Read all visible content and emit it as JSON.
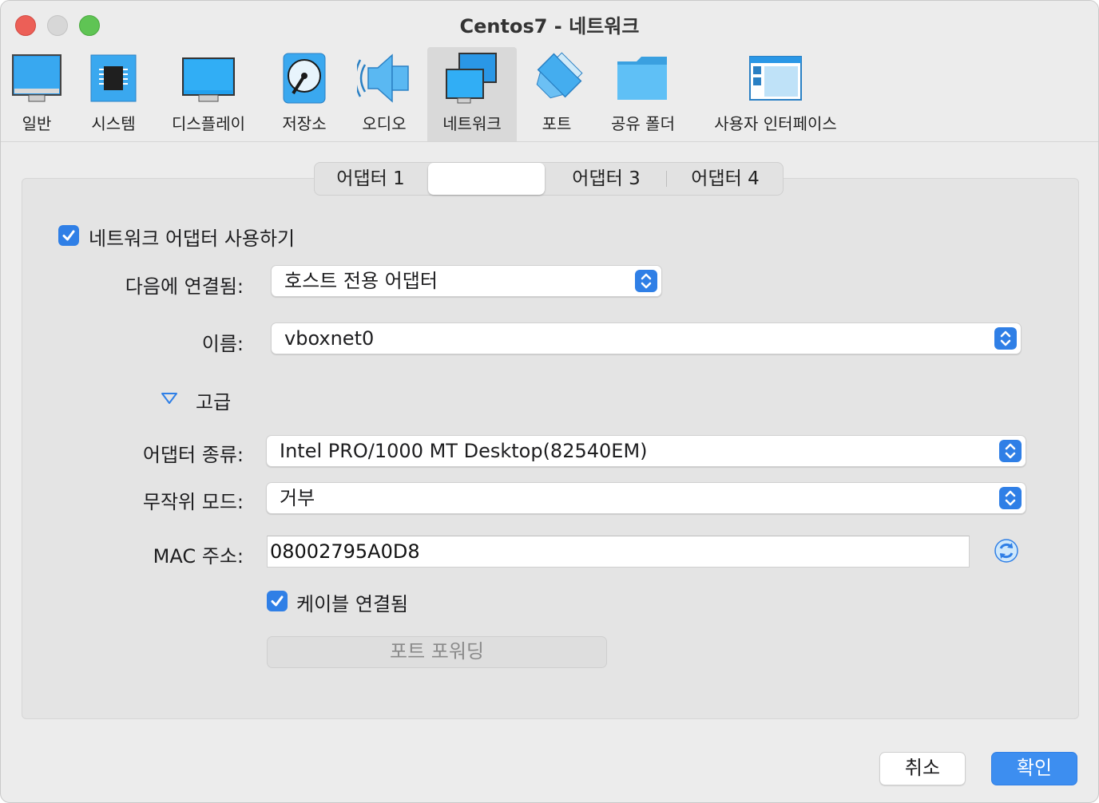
{
  "window": {
    "title": "Centos7 - 네트워크"
  },
  "toolbar": {
    "items": [
      {
        "label": "일반",
        "icon": "monitor-icon"
      },
      {
        "label": "시스템",
        "icon": "chip-icon"
      },
      {
        "label": "디스플레이",
        "icon": "display-icon"
      },
      {
        "label": "저장소",
        "icon": "disk-icon"
      },
      {
        "label": "오디오",
        "icon": "speaker-icon"
      },
      {
        "label": "네트워크",
        "icon": "network-icon",
        "active": true
      },
      {
        "label": "포트",
        "icon": "port-icon"
      },
      {
        "label": "공유 폴더",
        "icon": "folder-icon"
      },
      {
        "label": "사용자 인터페이스",
        "icon": "ui-window-icon"
      }
    ]
  },
  "tabs": [
    {
      "label": "어댑터 1"
    },
    {
      "label": ""
    },
    {
      "label": "어댑터 3"
    },
    {
      "label": "어댑터 4"
    }
  ],
  "form": {
    "enable_adapter": {
      "label": "네트워크 어댑터 사용하기",
      "checked": true
    },
    "attached_to": {
      "label": "다음에 연결됨:",
      "value": "호스트 전용 어댑터"
    },
    "name": {
      "label": "이름:",
      "value": "vboxnet0"
    },
    "advanced": {
      "label": "고급"
    },
    "adapter_type": {
      "label": "어댑터 종류:",
      "value": "Intel PRO/1000 MT Desktop(82540EM)"
    },
    "promiscuous_mode": {
      "label": "무작위 모드:",
      "value": "거부"
    },
    "mac_address": {
      "label": "MAC 주소:",
      "value": "08002795A0D8"
    },
    "cable_connected": {
      "label": "케이블 연결됨",
      "checked": true
    },
    "port_forwarding": {
      "label": "포트 포워딩"
    }
  },
  "buttons": {
    "cancel": "취소",
    "ok": "확인"
  },
  "colors": {
    "accent": "#2f7fe6",
    "ok_button": "#3d8ef0",
    "window_bg": "#ececec"
  }
}
